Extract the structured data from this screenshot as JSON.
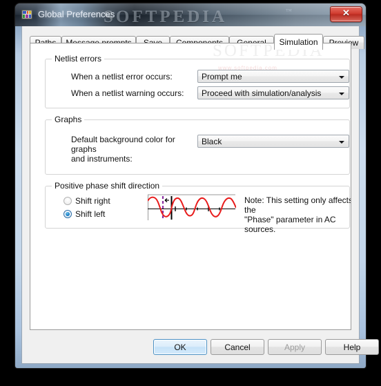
{
  "window": {
    "title": "Global Preferences",
    "icon": "preferences-icon",
    "close_label": "✕",
    "watermark": "SOFTPEDIA",
    "watermark_tm": "™"
  },
  "tabs": [
    {
      "label": "Paths",
      "selected": false
    },
    {
      "label": "Message prompts",
      "selected": false
    },
    {
      "label": "Save",
      "selected": false
    },
    {
      "label": "Components",
      "selected": false
    },
    {
      "label": "General",
      "selected": false
    },
    {
      "label": "Simulation",
      "selected": true
    },
    {
      "label": "Preview",
      "selected": false
    }
  ],
  "netlist_group": {
    "title": "Netlist errors",
    "error_label": "When a netlist error occurs:",
    "error_value": "Prompt me",
    "warning_label": "When a netlist warning occurs:",
    "warning_value": "Proceed with simulation/analysis"
  },
  "graphs_group": {
    "title": "Graphs",
    "bg_label_line1": "Default background color for graphs",
    "bg_label_line2": "and instruments:",
    "bg_value": "Black"
  },
  "phase_group": {
    "title": "Positive phase shift direction",
    "shift_right": "Shift right",
    "shift_left": "Shift left",
    "selected": "shift-left",
    "note_line1": "Note: This setting only affects the",
    "note_line2": "\"Phase\" parameter in AC sources.",
    "waveform_name": "phase-shift-waveform"
  },
  "footer": {
    "ok": "OK",
    "cancel": "Cancel",
    "apply": "Apply",
    "help": "Help",
    "apply_disabled": true
  },
  "body_watermark": {
    "text": "SOFTPEDIA",
    "tm": "™",
    "sub": "www.softpedia.com"
  },
  "colors": {
    "accent": "#2084c9",
    "waveform": "#e81c1c",
    "marker": "#8b2fa0",
    "dialog_bg": "#f0f0f0",
    "page_bg": "#ffffff"
  }
}
